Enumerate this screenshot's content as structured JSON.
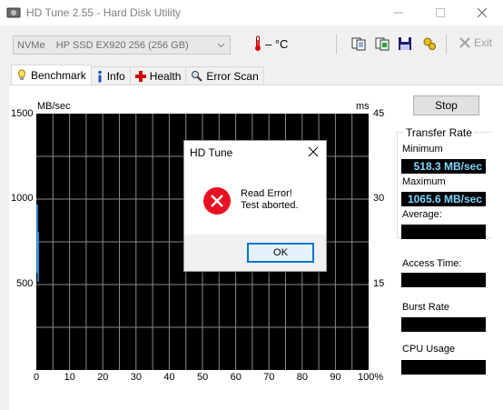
{
  "window": {
    "title": "HD Tune 2.55 - Hard Disk Utility"
  },
  "toolbar": {
    "drive": "NVMe    HP SSD EX920 256 (256 GB)",
    "temperature": "– °C",
    "exit_label": "Exit"
  },
  "tabs": [
    {
      "label": "Benchmark",
      "active": true
    },
    {
      "label": "Info"
    },
    {
      "label": "Health"
    },
    {
      "label": "Error Scan"
    }
  ],
  "chart": {
    "y_left_unit": "MB/sec",
    "y_right_unit": "ms",
    "y_left_ticks": [
      "1500",
      "1000",
      "500"
    ],
    "y_right_ticks": [
      "45",
      "30",
      "15"
    ],
    "x_ticks": [
      "0",
      "10",
      "20",
      "30",
      "40",
      "50",
      "60",
      "70",
      "80",
      "90",
      "100%"
    ]
  },
  "right_panel": {
    "stop_label": "Stop",
    "transfer_rate_title": "Transfer Rate",
    "minimum_label": "Minimum",
    "minimum_value": "518.3 MB/sec",
    "maximum_label": "Maximum",
    "maximum_value": "1065.6 MB/sec",
    "average_label": "Average:",
    "access_time_label": "Access Time:",
    "burst_rate_label": "Burst Rate",
    "cpu_usage_label": "CPU Usage"
  },
  "dialog": {
    "title": "HD Tune",
    "message_line1": "Read Error!",
    "message_line2": "Test aborted.",
    "ok_label": "OK"
  },
  "colors": {
    "chart_bg": "#000000",
    "grid": "#8a8a8a",
    "value_text": "#7fd7ff",
    "error_red": "#e81123",
    "focus_blue": "#0078d7"
  }
}
